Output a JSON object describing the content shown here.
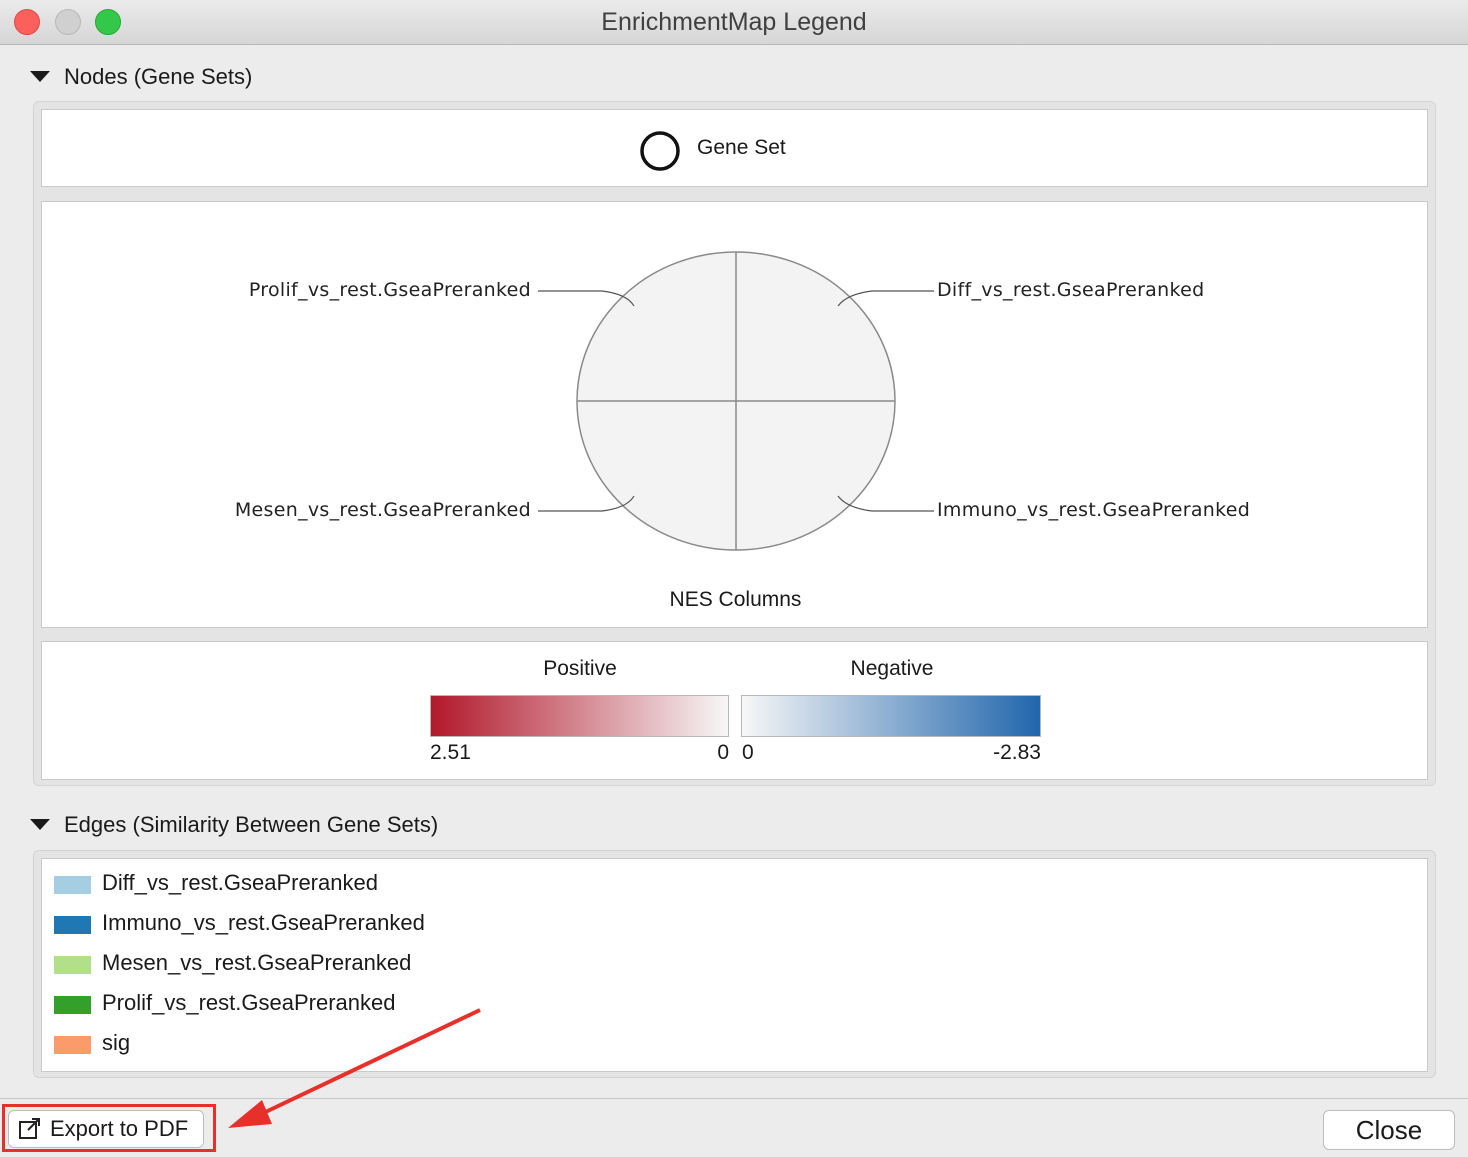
{
  "window": {
    "title": "EnrichmentMap Legend"
  },
  "nodes_section": {
    "header": "Nodes (Gene Sets)",
    "gene_set_label": "Gene Set",
    "chart_labels": {
      "top_left": "Prolif_vs_rest.GseaPreranked",
      "top_right": "Diff_vs_rest.GseaPreranked",
      "bottom_left": "Mesen_vs_rest.GseaPreranked",
      "bottom_right": "Immuno_vs_rest.GseaPreranked"
    },
    "chart_caption": "NES Columns",
    "scale": {
      "positive_label": "Positive",
      "negative_label": "Negative",
      "positive_max": "2.51",
      "positive_min": "0",
      "negative_min": "0",
      "negative_max": "-2.83",
      "positive_color": "#b2182b",
      "negative_color": "#2166ac"
    }
  },
  "edges_section": {
    "header": "Edges (Similarity Between Gene Sets)",
    "items": [
      {
        "label": "Diff_vs_rest.GseaPreranked",
        "color": "#a6cee3"
      },
      {
        "label": "Immuno_vs_rest.GseaPreranked",
        "color": "#1f78b4"
      },
      {
        "label": "Mesen_vs_rest.GseaPreranked",
        "color": "#b2df8a"
      },
      {
        "label": "Prolif_vs_rest.GseaPreranked",
        "color": "#33a02c"
      },
      {
        "label": "sig",
        "color": "#fb9a6a"
      }
    ]
  },
  "footer": {
    "export_label": "Export to PDF",
    "export_icon": "external-link-icon",
    "close_label": "Close"
  }
}
